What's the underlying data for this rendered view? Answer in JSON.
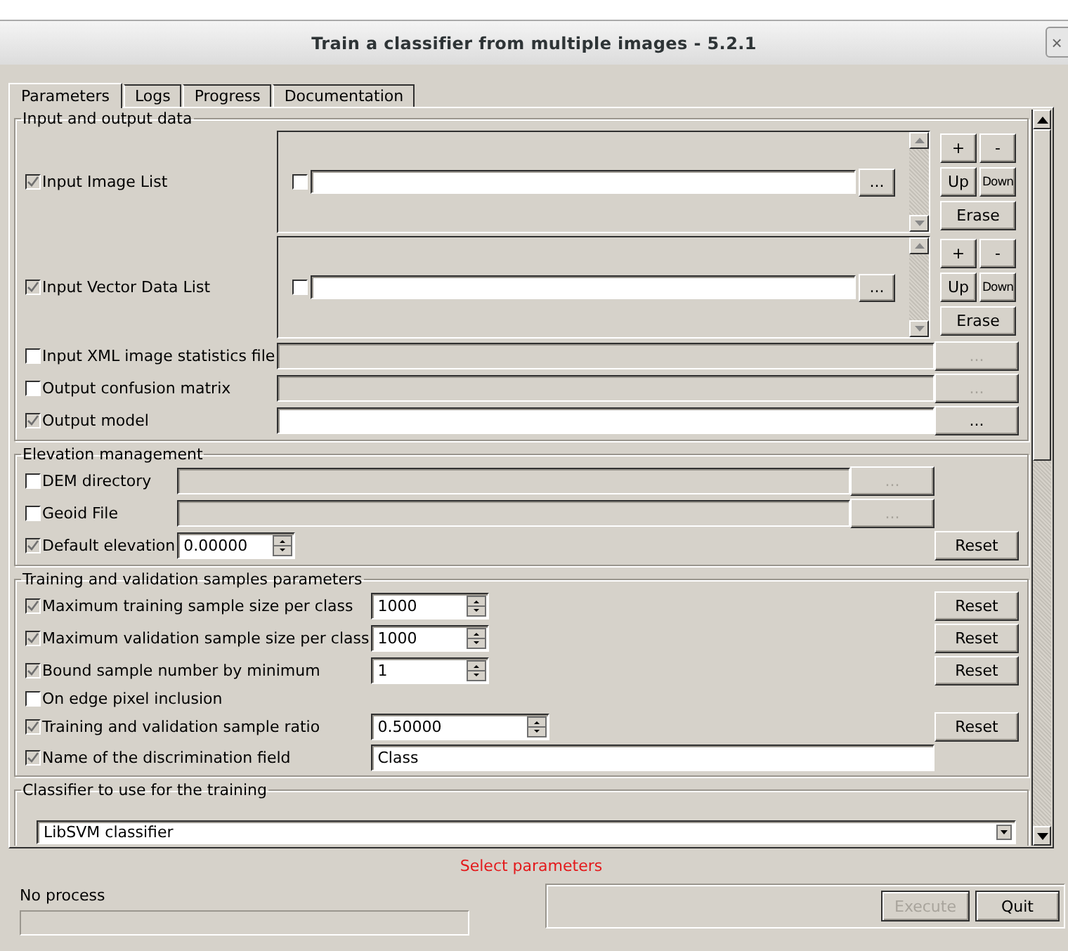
{
  "window": {
    "title": "Train a classifier from multiple images - 5.2.1",
    "close": "×"
  },
  "tabs": [
    {
      "label": "Parameters",
      "selected": true
    },
    {
      "label": "Logs",
      "selected": false
    },
    {
      "label": "Progress",
      "selected": false
    },
    {
      "label": "Documentation",
      "selected": false
    }
  ],
  "groups": [
    {
      "title": "Input and output data",
      "rows": [
        {
          "kind": "list",
          "label": "Input Image List",
          "checked": true,
          "item_checked": false,
          "browse": "...",
          "buttons": [
            "+",
            "-",
            "Up",
            "Down",
            "Erase"
          ]
        },
        {
          "kind": "list",
          "label": "Input Vector Data List",
          "checked": true,
          "item_checked": false,
          "browse": "...",
          "buttons": [
            "+",
            "-",
            "Up",
            "Down",
            "Erase"
          ]
        },
        {
          "kind": "file",
          "label": "Input XML image statistics file",
          "checked": false,
          "browse": "..."
        },
        {
          "kind": "file",
          "label": "Output confusion matrix",
          "checked": false,
          "browse": "..."
        },
        {
          "kind": "file",
          "label": "Output model",
          "checked": true,
          "browse": "..."
        }
      ]
    },
    {
      "title": "Elevation management",
      "rows": [
        {
          "kind": "file",
          "label": "DEM directory",
          "checked": false,
          "browse": "..."
        },
        {
          "kind": "file",
          "label": "Geoid File",
          "checked": false,
          "browse": "..."
        },
        {
          "kind": "spin",
          "label": "Default elevation",
          "checked": true,
          "value": "0.00000",
          "reset": "Reset"
        }
      ]
    },
    {
      "title": "Training and validation samples parameters",
      "rows": [
        {
          "kind": "spin",
          "label": "Maximum training sample size per class",
          "checked": true,
          "value": "1000",
          "reset": "Reset"
        },
        {
          "kind": "spin",
          "label": "Maximum validation sample size per class",
          "checked": true,
          "value": "1000",
          "reset": "Reset"
        },
        {
          "kind": "spin",
          "label": "Bound sample number by minimum",
          "checked": true,
          "value": "1",
          "reset": "Reset"
        },
        {
          "kind": "check",
          "label": "On edge pixel inclusion",
          "checked": false
        },
        {
          "kind": "spinwide",
          "label": "Training and validation sample ratio",
          "checked": true,
          "value": "0.50000",
          "reset": "Reset"
        },
        {
          "kind": "text",
          "label": "Name of the discrimination field",
          "checked": true,
          "value": "Class"
        }
      ]
    },
    {
      "title": "Classifier to use for the training",
      "rows": [
        {
          "kind": "combo",
          "value": "LibSVM classifier"
        }
      ]
    }
  ],
  "status": "Select parameters",
  "progress": {
    "label": "No process",
    "level": 0
  },
  "actions": [
    {
      "label": "Execute",
      "disabled": true
    },
    {
      "label": "Quit",
      "disabled": false
    }
  ]
}
